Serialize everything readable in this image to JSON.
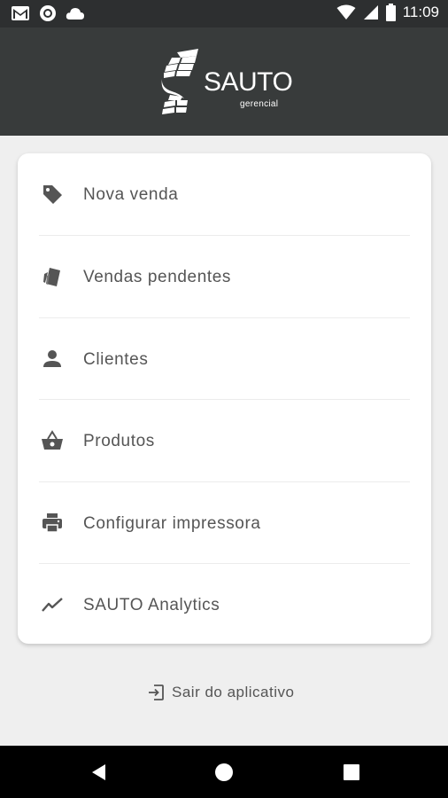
{
  "status_bar": {
    "time": "11:09",
    "left_icons": [
      "gmail-icon",
      "record-icon",
      "cloud-icon"
    ],
    "right_icons": [
      "wifi-icon",
      "signal-icon",
      "battery-icon"
    ]
  },
  "header": {
    "logo_text": "SAUTO",
    "logo_subtitle": "gerencial",
    "background": "#383b3b"
  },
  "menu": {
    "items": [
      {
        "label": "Nova venda",
        "icon": "tag-icon"
      },
      {
        "label": "Vendas pendentes",
        "icon": "tickets-icon"
      },
      {
        "label": "Clientes",
        "icon": "person-icon"
      },
      {
        "label": "Produtos",
        "icon": "basket-icon"
      },
      {
        "label": "Configurar impressora",
        "icon": "printer-icon"
      },
      {
        "label": "SAUTO Analytics",
        "icon": "trending-icon"
      }
    ]
  },
  "logout": {
    "label": "Sair do aplicativo",
    "icon": "exit-icon"
  },
  "nav_bar": {
    "buttons": [
      "back-icon",
      "home-icon",
      "recents-icon"
    ]
  }
}
